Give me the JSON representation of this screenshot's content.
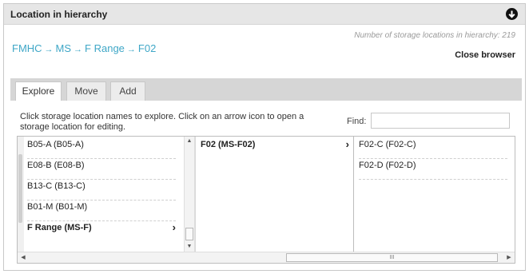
{
  "panel": {
    "title": "Location in hierarchy",
    "collapse_icon": "circle-chevron-down-icon",
    "storage_count": "Number of storage locations in hierarchy: 219",
    "close_label": "Close browser"
  },
  "breadcrumb": {
    "items": [
      "FMHC",
      "MS",
      "F Range",
      "F02"
    ],
    "separator": "→"
  },
  "tabs": [
    {
      "label": "Explore",
      "active": true
    },
    {
      "label": "Move",
      "active": false
    },
    {
      "label": "Add",
      "active": false
    }
  ],
  "explore": {
    "instructions": "Click storage location names to explore. Click on an arrow icon to open a storage location for editing.",
    "find_label": "Find:",
    "find_value": ""
  },
  "columns": {
    "col1": [
      {
        "label": "B05-A (B05-A)"
      },
      {
        "label": "E08-B (E08-B)"
      },
      {
        "label": "B13-C (B13-C)"
      },
      {
        "label": "B01-M (B01-M)"
      },
      {
        "label": "F Range (MS-F)",
        "selected": true,
        "arrow": "›"
      }
    ],
    "col2": [
      {
        "label": "F02 (MS-F02)",
        "selected": true,
        "arrow": "›"
      }
    ],
    "col3": [
      {
        "label": "F02-C (F02-C)"
      },
      {
        "label": "F02-D (F02-D)"
      }
    ]
  },
  "scrollbar": {
    "thumb_grip": "III"
  },
  "colors": {
    "link": "#3fa7c7",
    "header_bg": "#e6e6e6",
    "tabbar_bg": "#d6d6d6"
  }
}
